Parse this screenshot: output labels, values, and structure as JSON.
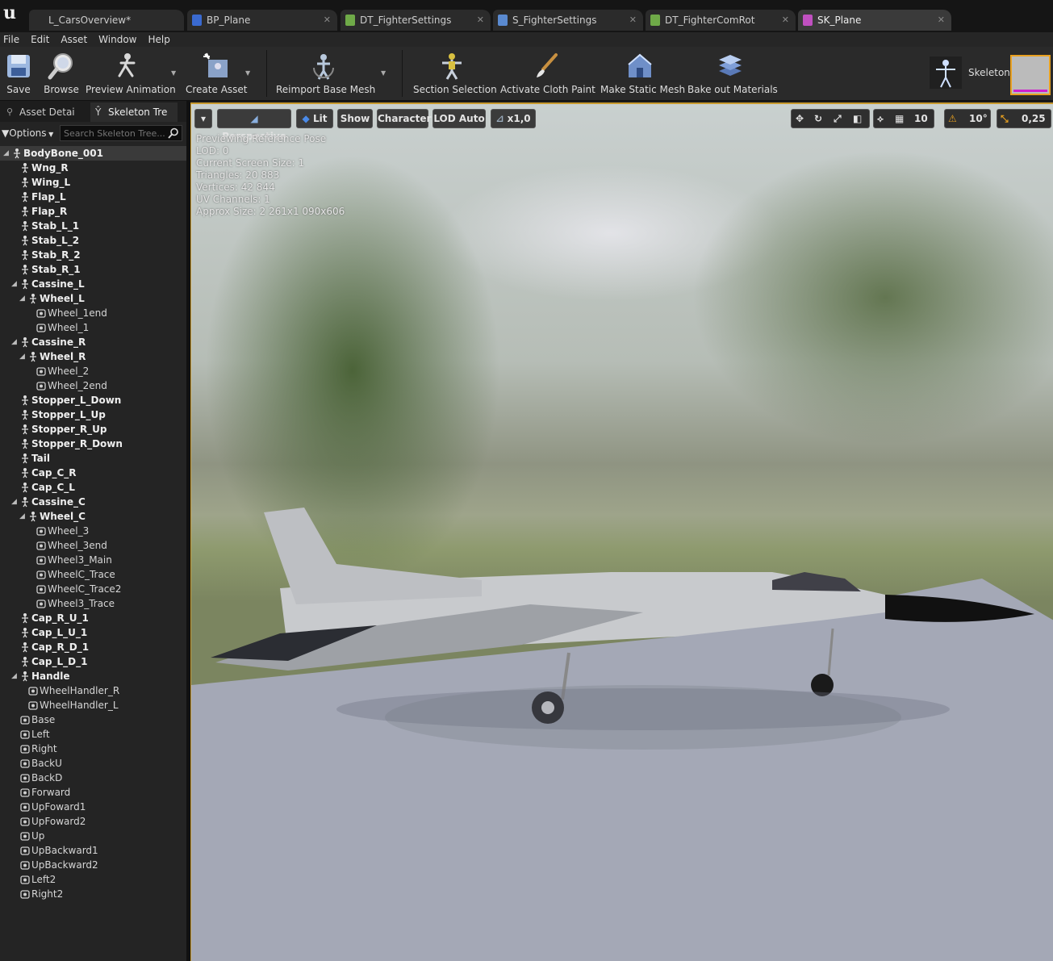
{
  "tabs": [
    {
      "label": "L_CarsOverview*",
      "color": "#444"
    },
    {
      "label": "BP_Plane",
      "color": "#3a6ad0"
    },
    {
      "label": "DT_FighterSettings",
      "color": "#7fbf4f"
    },
    {
      "label": "S_FighterSettings",
      "color": "#5a8ad0"
    },
    {
      "label": "DT_FighterComRot",
      "color": "#7fbf4f"
    },
    {
      "label": "SK_Plane",
      "color": "#d060d0",
      "active": true
    }
  ],
  "menu": [
    "File",
    "Edit",
    "Asset",
    "Window",
    "Help"
  ],
  "toolbar": {
    "save": "Save",
    "browse": "Browse",
    "preview_animation": "Preview Animation",
    "create_asset": "Create Asset",
    "reimport_base_mesh": "Reimport Base Mesh",
    "section_selection": "Section Selection",
    "activate_cloth_paint": "Activate Cloth Paint",
    "make_static_mesh": "Make Static Mesh",
    "bake_out_materials": "Bake out Materials",
    "skeleton": "Skeleton"
  },
  "left_panel": {
    "tab_asset_details": "Asset Detai",
    "tab_skeleton_tree": "Skeleton Tre",
    "options": "Options",
    "search_placeholder": "Search Skeleton Tree..."
  },
  "bones": [
    {
      "name": "BodyBone_001",
      "depth": 0,
      "exp": true,
      "type": "bone",
      "selected": true
    },
    {
      "name": "Wng_R",
      "depth": 1,
      "type": "bone"
    },
    {
      "name": "Wing_L",
      "depth": 1,
      "type": "bone"
    },
    {
      "name": "Flap_L",
      "depth": 1,
      "type": "bone"
    },
    {
      "name": "Flap_R",
      "depth": 1,
      "type": "bone"
    },
    {
      "name": "Stab_L_1",
      "depth": 1,
      "type": "bone"
    },
    {
      "name": "Stab_L_2",
      "depth": 1,
      "type": "bone"
    },
    {
      "name": "Stab_R_2",
      "depth": 1,
      "type": "bone"
    },
    {
      "name": "Stab_R_1",
      "depth": 1,
      "type": "bone"
    },
    {
      "name": "Cassine_L",
      "depth": 1,
      "exp": true,
      "type": "bone"
    },
    {
      "name": "Wheel_L",
      "depth": 2,
      "exp": true,
      "type": "bone"
    },
    {
      "name": "Wheel_1end",
      "depth": 3,
      "type": "socket"
    },
    {
      "name": "Wheel_1",
      "depth": 3,
      "type": "socket"
    },
    {
      "name": "Cassine_R",
      "depth": 1,
      "exp": true,
      "type": "bone"
    },
    {
      "name": "Wheel_R",
      "depth": 2,
      "exp": true,
      "type": "bone"
    },
    {
      "name": "Wheel_2",
      "depth": 3,
      "type": "socket"
    },
    {
      "name": "Wheel_2end",
      "depth": 3,
      "type": "socket"
    },
    {
      "name": "Stopper_L_Down",
      "depth": 1,
      "type": "bone"
    },
    {
      "name": "Stopper_L_Up",
      "depth": 1,
      "type": "bone"
    },
    {
      "name": "Stopper_R_Up",
      "depth": 1,
      "type": "bone"
    },
    {
      "name": "Stopper_R_Down",
      "depth": 1,
      "type": "bone"
    },
    {
      "name": "Tail",
      "depth": 1,
      "type": "bone"
    },
    {
      "name": "Cap_C_R",
      "depth": 1,
      "type": "bone"
    },
    {
      "name": "Cap_C_L",
      "depth": 1,
      "type": "bone"
    },
    {
      "name": "Cassine_C",
      "depth": 1,
      "exp": true,
      "type": "bone"
    },
    {
      "name": "Wheel_C",
      "depth": 2,
      "exp": true,
      "type": "bone"
    },
    {
      "name": "Wheel_3",
      "depth": 3,
      "type": "socket"
    },
    {
      "name": "Wheel_3end",
      "depth": 3,
      "type": "socket"
    },
    {
      "name": "Wheel3_Main",
      "depth": 3,
      "type": "socket"
    },
    {
      "name": "WheelC_Trace",
      "depth": 3,
      "type": "socket"
    },
    {
      "name": "WheelC_Trace2",
      "depth": 3,
      "type": "socket"
    },
    {
      "name": "Wheel3_Trace",
      "depth": 3,
      "type": "socket"
    },
    {
      "name": "Cap_R_U_1",
      "depth": 1,
      "type": "bone"
    },
    {
      "name": "Cap_L_U_1",
      "depth": 1,
      "type": "bone"
    },
    {
      "name": "Cap_R_D_1",
      "depth": 1,
      "type": "bone"
    },
    {
      "name": "Cap_L_D_1",
      "depth": 1,
      "type": "bone"
    },
    {
      "name": "Handle",
      "depth": 1,
      "exp": true,
      "type": "bone"
    },
    {
      "name": "WheelHandler_R",
      "depth": 2,
      "type": "socket"
    },
    {
      "name": "WheelHandler_L",
      "depth": 2,
      "type": "socket"
    },
    {
      "name": "Base",
      "depth": 1,
      "type": "socket"
    },
    {
      "name": "Left",
      "depth": 1,
      "type": "socket"
    },
    {
      "name": "Right",
      "depth": 1,
      "type": "socket"
    },
    {
      "name": "BackU",
      "depth": 1,
      "type": "socket"
    },
    {
      "name": "BackD",
      "depth": 1,
      "type": "socket"
    },
    {
      "name": "Forward",
      "depth": 1,
      "type": "socket"
    },
    {
      "name": "UpFoward1",
      "depth": 1,
      "type": "socket"
    },
    {
      "name": "UpFoward2",
      "depth": 1,
      "type": "socket"
    },
    {
      "name": "Up",
      "depth": 1,
      "type": "socket"
    },
    {
      "name": "UpBackward1",
      "depth": 1,
      "type": "socket"
    },
    {
      "name": "UpBackward2",
      "depth": 1,
      "type": "socket"
    },
    {
      "name": "Left2",
      "depth": 1,
      "type": "socket"
    },
    {
      "name": "Right2",
      "depth": 1,
      "type": "socket"
    }
  ],
  "viewport": {
    "perspective": "Perspective",
    "lit": "Lit",
    "show": "Show",
    "character": "Character",
    "lod": "LOD Auto",
    "speed": "x1,0",
    "grid_snap": "10",
    "rot_snap": "10°",
    "scale_snap": "0,25",
    "info": [
      "Previewing Reference Pose",
      "LOD: 0",
      "Current Screen Size: 1",
      "Triangles: 20 883",
      "Vertices: 42 844",
      "UV Channels: 1",
      "Approx Size: 2 261x1 090x606"
    ]
  },
  "colors": {
    "accent": "#c89a2e",
    "skeleton_underline": "#d020d0"
  }
}
